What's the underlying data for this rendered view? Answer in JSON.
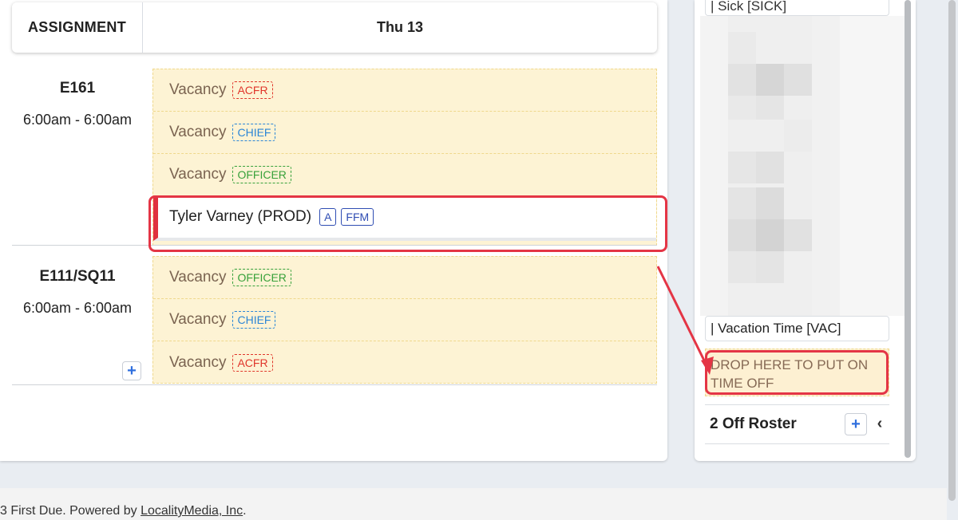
{
  "header": {
    "assignment_col": "ASSIGNMENT",
    "day_col": "Thu 13"
  },
  "assignments": [
    {
      "name": "E161",
      "time": "6:00am - 6:00am",
      "slots": [
        {
          "text": "Vacancy",
          "tag": "ACFR"
        },
        {
          "text": "Vacancy",
          "tag": "CHIEF"
        },
        {
          "text": "Vacancy",
          "tag": "OFFICER"
        },
        {
          "text": "Tyler Varney (PROD)",
          "tags": [
            "A",
            "FFM"
          ]
        }
      ]
    },
    {
      "name": "E111/SQ11",
      "time": "6:00am - 6:00am",
      "slots": [
        {
          "text": "Vacancy",
          "tag": "OFFICER"
        },
        {
          "text": "Vacancy",
          "tag": "CHIEF"
        },
        {
          "text": "Vacancy",
          "tag": "ACFR"
        }
      ]
    }
  ],
  "right_panel": {
    "top_card": "| Sick [SICK]",
    "vacation_card": "| Vacation Time [VAC]",
    "drop_zone": "DROP HERE TO PUT ON TIME OFF",
    "off_roster_title": "2 Off Roster"
  },
  "icons": {
    "add": "plus-icon",
    "collapse": "chevron-left-icon"
  },
  "colors": {
    "highlight": "#e43545",
    "vacancy_bg": "#fdf3d4",
    "acfr": "#e0362b",
    "chief": "#2b86d6",
    "officer": "#37a13a"
  },
  "footer": {
    "prefix": "3 First Due. Powered by ",
    "link": "LocalityMedia, Inc",
    "suffix": "."
  }
}
